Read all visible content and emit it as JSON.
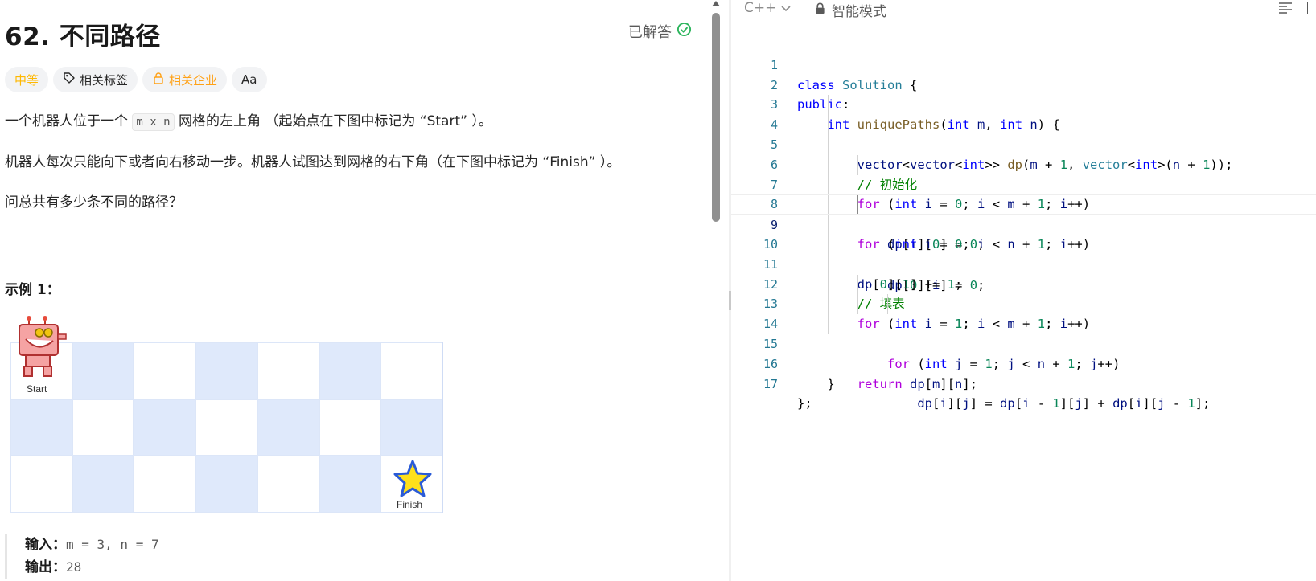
{
  "problem": {
    "title": "62. 不同路径",
    "status": "已解答",
    "tags": {
      "difficulty": "中等",
      "related_tags": "相关标签",
      "related_companies": "相关企业",
      "font_toggle": "Aa"
    },
    "desc_p1_before": "一个机器人位于一个",
    "desc_p1_code": "m x n",
    "desc_p1_after": "网格的左上角 （起始点在下图中标记为 “Start” ）。",
    "desc_p2": "机器人每次只能向下或者向右移动一步。机器人试图达到网格的右下角（在下图中标记为 “Finish” ）。",
    "desc_p3": "问总共有多少条不同的路径？",
    "example_title": "示例 1：",
    "figure": {
      "start_label": "Start",
      "finish_label": "Finish"
    },
    "example": {
      "input_label": "输入：",
      "input_value": "m = 3, n = 7",
      "output_label": "输出：",
      "output_value": "28"
    }
  },
  "editor": {
    "language": "C++",
    "mode": "智能模式",
    "line_numbers": [
      "1",
      "2",
      "3",
      "4",
      "5",
      "6",
      "7",
      "8",
      "9",
      "10",
      "11",
      "12",
      "13",
      "14",
      "15",
      "16",
      "17"
    ],
    "comment_init": "// 初始化",
    "comment_fill": "// 填表"
  },
  "colors": {
    "difficulty_medium": "#ffb800",
    "accepted_green": "#2db55d",
    "grid_blue": "#dfe9fb",
    "keyword_blue": "#0000ff",
    "control_purple": "#af00db",
    "type_teal": "#267f99",
    "comment_green": "#008000",
    "number_green": "#098658"
  }
}
